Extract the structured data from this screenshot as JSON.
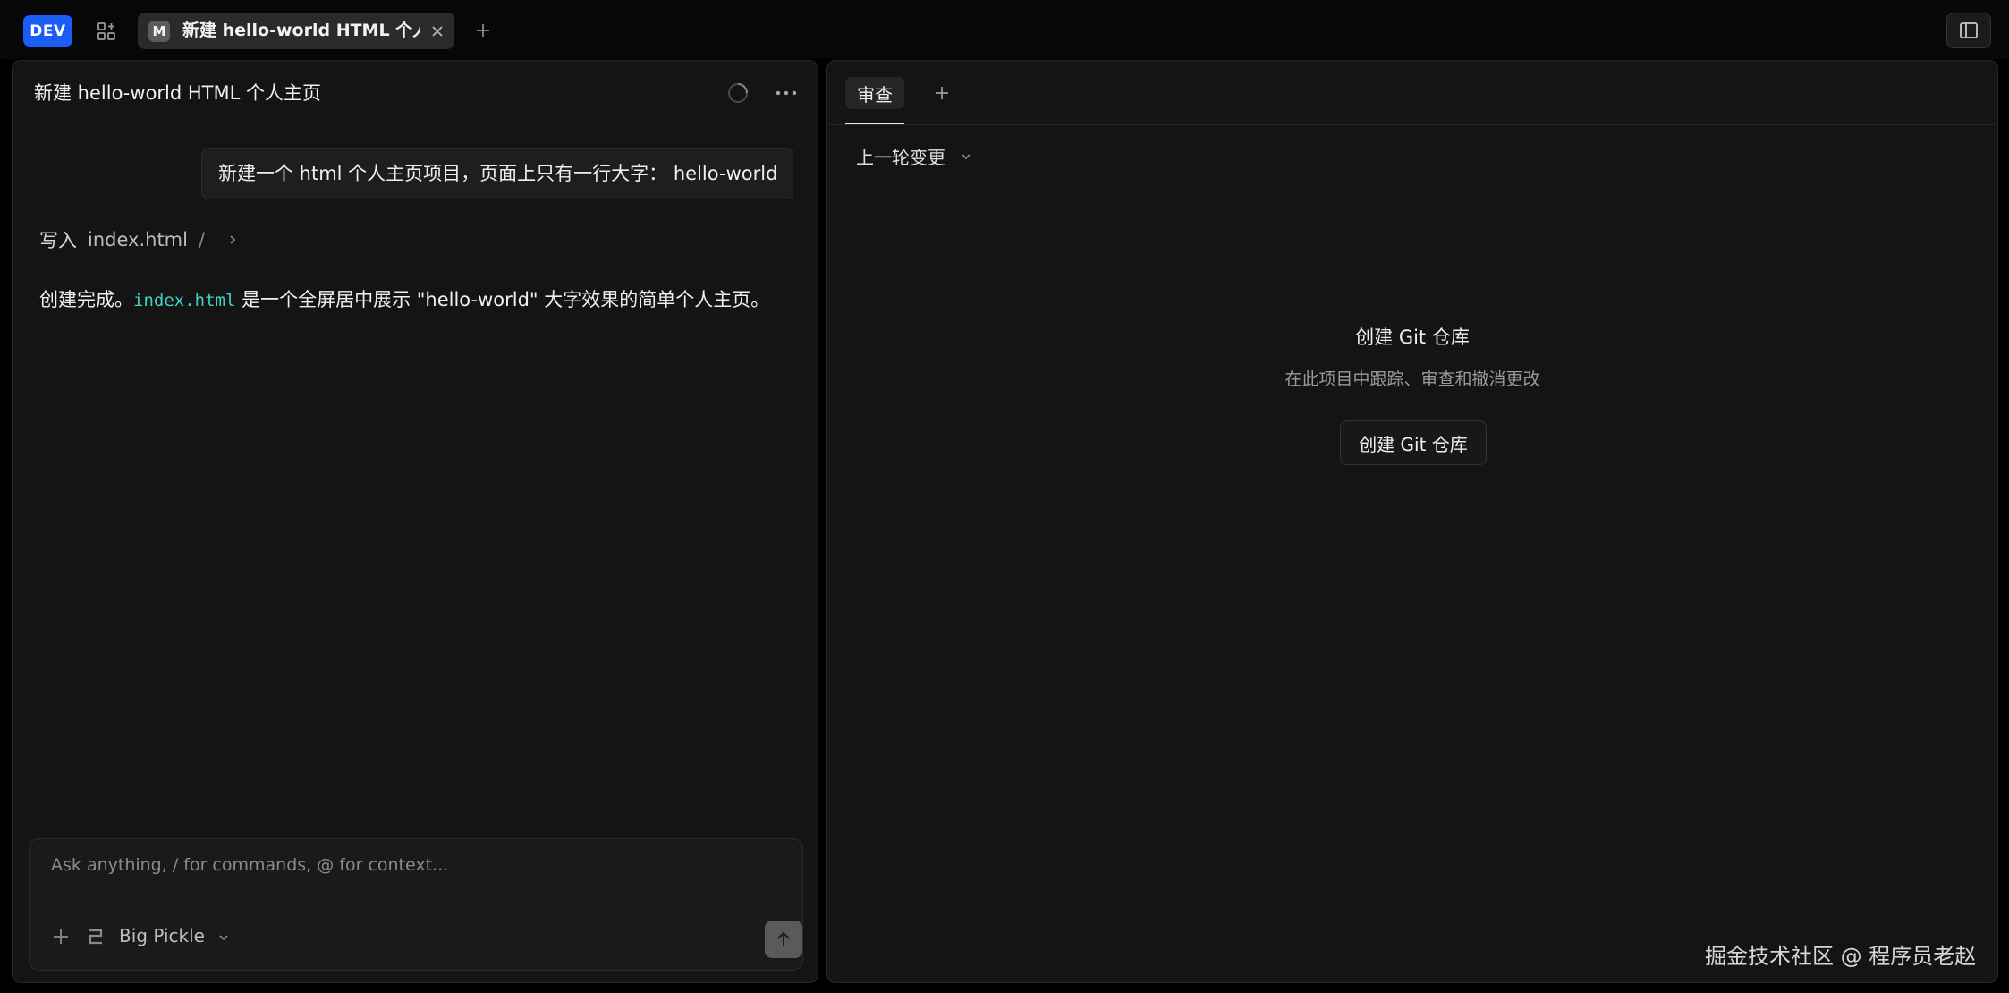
{
  "topbar": {
    "env_badge": "DEV",
    "tab": {
      "icon_letter": "M",
      "title": "新建 hello-world HTML 个人主页"
    }
  },
  "left_panel": {
    "title": "新建 hello-world HTML 个人主页",
    "user_message": "新建一个 html 个人主页项目，页面上只有一行大字： hello-world",
    "tool_call": {
      "verb": "写入",
      "file": "index.html",
      "separator": "/"
    },
    "result": {
      "prefix": "创建完成。",
      "code": "index.html",
      "suffix": " 是一个全屏居中展示 \"hello-world\" 大字效果的简单个人主页。"
    },
    "composer": {
      "placeholder": "Ask anything, / for commands, @ for context...",
      "model": "Big Pickle"
    }
  },
  "right_panel": {
    "tab_label": "审查",
    "changes_label": "上一轮变更",
    "empty_title": "创建 Git 仓库",
    "empty_desc": "在此项目中跟踪、审查和撤消更改",
    "create_button": "创建 Git 仓库"
  },
  "watermark": "掘金技术社区 @ 程序员老赵",
  "colors": {
    "accent": "#1a5cf5",
    "code": "#3fd1c2",
    "background": "#141414"
  }
}
